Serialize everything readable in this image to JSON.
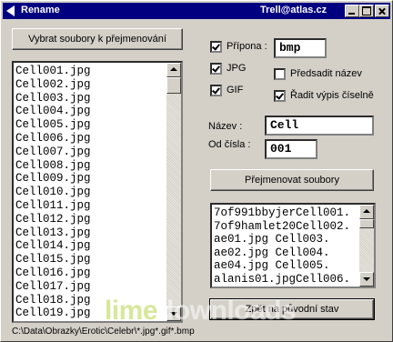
{
  "window": {
    "title": "Rename",
    "user": "Trell@atlas.cz"
  },
  "buttons": {
    "select_files": "Vybrat soubory k přejmenování",
    "rename_files": "Přejmenovat soubory",
    "restore": "Zpět na původní stav"
  },
  "options": {
    "extension_label": "Přípona :",
    "extension_checked": true,
    "extension_value": "bmp",
    "jpg_label": "JPG",
    "jpg_checked": true,
    "gif_label": "GIF",
    "gif_checked": true,
    "prefix_label": "Předsadit název",
    "prefix_checked": false,
    "sort_label": "Řadit výpis číselně",
    "sort_checked": true
  },
  "name_field": {
    "label": "Název :",
    "value": "Cell"
  },
  "start_field": {
    "label": "Od čísla :",
    "value": "001"
  },
  "file_list": [
    "Cell001.jpg",
    "Cell002.jpg",
    "Cell003.jpg",
    "Cell004.jpg",
    "Cell005.jpg",
    "Cell006.jpg",
    "Cell007.jpg",
    "Cell008.jpg",
    "Cell009.jpg",
    "Cell010.jpg",
    "Cell011.jpg",
    "Cell012.jpg",
    "Cell013.jpg",
    "Cell014.jpg",
    "Cell015.jpg",
    "Cell016.jpg",
    "Cell017.jpg",
    "Cell018.jpg",
    "Cell019.jpg"
  ],
  "rename_list": [
    "7of991bbyjerCell001.",
    "7of9hamlet20Cell002.",
    "ae01.jpg    Cell003.",
    "ae02.jpg    Cell004.",
    "ae04.jpg    Cell005.",
    "alanis01.jpgCell006."
  ],
  "status_path": "C:\\Data\\Obrazky\\Erotic\\Celebr\\*.jpg*.gif*.bmp",
  "watermark": {
    "part1": "lime",
    "part2": "downloads"
  }
}
